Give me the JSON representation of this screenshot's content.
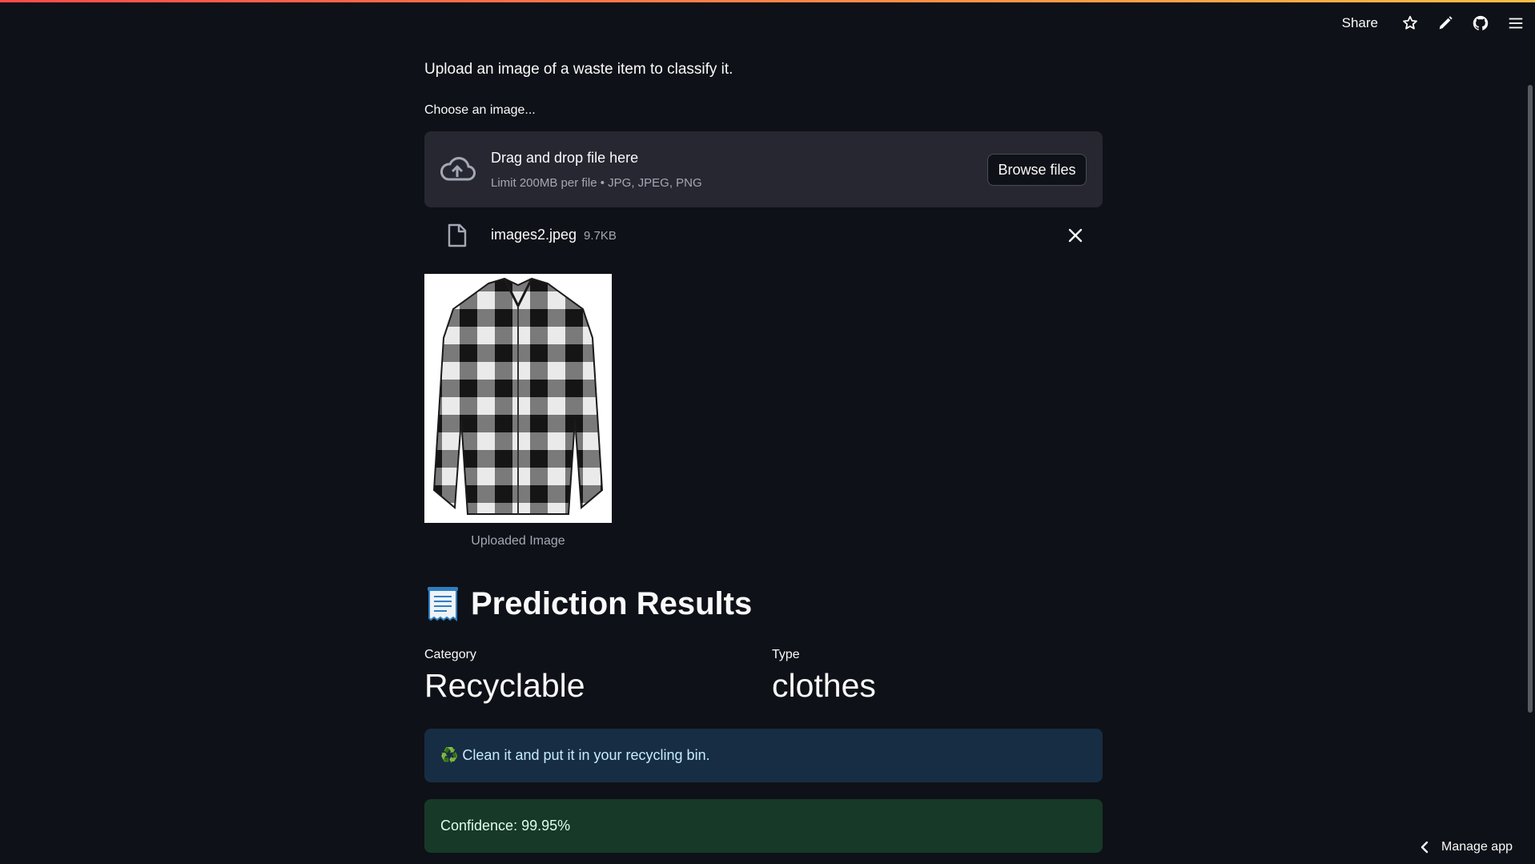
{
  "header": {
    "share_label": "Share",
    "icons": [
      "star-icon",
      "pencil-icon",
      "github-icon",
      "menu-icon"
    ]
  },
  "intro_text": "Upload an image of a waste item to classify it.",
  "uploader": {
    "label": "Choose an image...",
    "drop_title": "Drag and drop file here",
    "limit_text": "Limit 200MB per file • JPG, JPEG, PNG",
    "browse_label": "Browse files"
  },
  "file": {
    "name": "images2.jpeg",
    "size": "9.7KB"
  },
  "image": {
    "caption": "Uploaded Image"
  },
  "results": {
    "heading": "Prediction Results",
    "category_label": "Category",
    "category_value": "Recyclable",
    "type_label": "Type",
    "type_value": "clothes",
    "info_text": "♻️ Clean it and put it in your recycling bin.",
    "confidence_text": "Confidence: 99.95%"
  },
  "footer": {
    "manage_label": "Manage app"
  },
  "colors": {
    "background": "#0e1117",
    "dropzone": "#262730",
    "info_bg": "#172d43",
    "success_bg": "#173928"
  }
}
